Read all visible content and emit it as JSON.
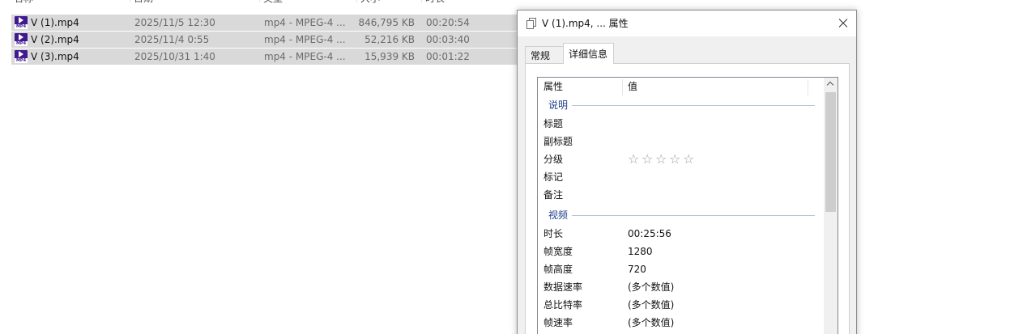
{
  "file_list": {
    "columns": [
      "名称",
      "日期",
      "类型",
      "大小",
      "时长"
    ],
    "rows": [
      {
        "name": "V (1).mp4",
        "date": "2025/11/5 12:30",
        "type": "mp4 - MPEG-4 ...",
        "size": "846,795 KB",
        "duration": "00:20:54"
      },
      {
        "name": "V (2).mp4",
        "date": "2025/11/4 0:55",
        "type": "mp4 - MPEG-4 ...",
        "size": "52,216 KB",
        "duration": "00:03:40"
      },
      {
        "name": "V (3).mp4",
        "date": "2025/10/31 1:40",
        "type": "mp4 - MPEG-4 ...",
        "size": "15,939 KB",
        "duration": "00:01:22"
      }
    ],
    "file_icon_tag": "MP4"
  },
  "dialog": {
    "title": "V (1).mp4, ... 属性",
    "tabs": [
      {
        "label": "常规",
        "active": false
      },
      {
        "label": "详细信息",
        "active": true
      }
    ],
    "grid": {
      "col_property": "属性",
      "col_value": "值",
      "groups": [
        {
          "label": "说明",
          "props": [
            {
              "key": "标题",
              "value": ""
            },
            {
              "key": "副标题",
              "value": ""
            },
            {
              "key": "分级",
              "value": "",
              "rating": 0
            },
            {
              "key": "标记",
              "value": ""
            },
            {
              "key": "备注",
              "value": ""
            }
          ]
        },
        {
          "label": "视频",
          "props": [
            {
              "key": "时长",
              "value": "00:25:56"
            },
            {
              "key": "帧宽度",
              "value": "1280"
            },
            {
              "key": "帧高度",
              "value": "720"
            },
            {
              "key": "数据速率",
              "value": "(多个数值)"
            },
            {
              "key": "总比特率",
              "value": "(多个数值)"
            },
            {
              "key": "帧速率",
              "value": "(多个数值)"
            }
          ]
        }
      ]
    }
  }
}
